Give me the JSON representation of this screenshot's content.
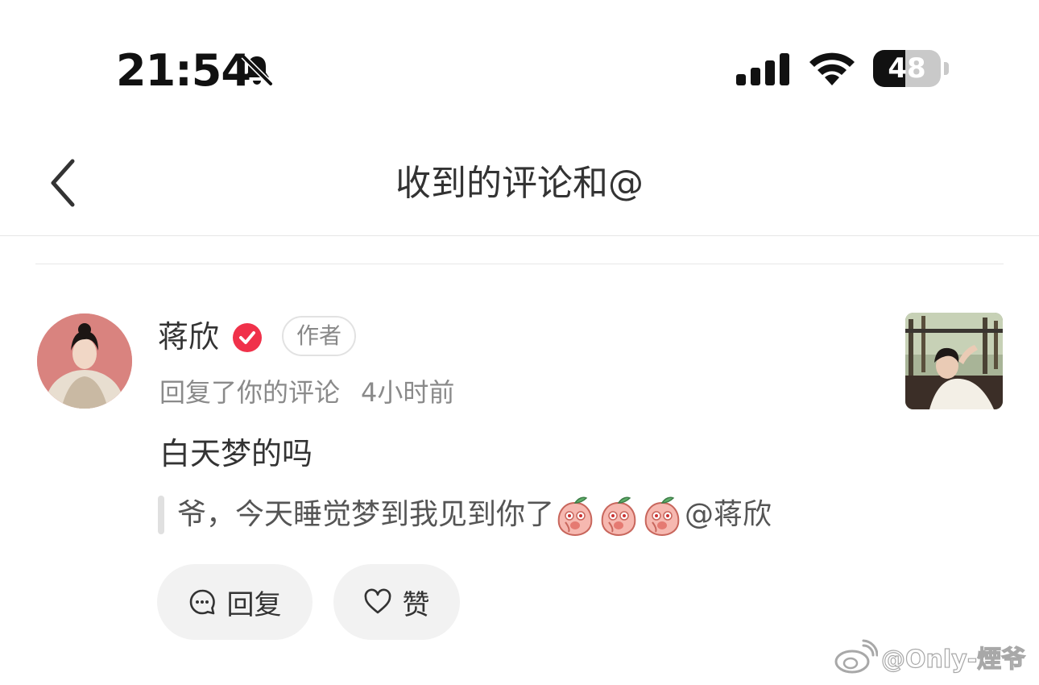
{
  "status_bar": {
    "time": "21:54",
    "battery_level": "48",
    "battery_fraction": 0.48,
    "icons": [
      "bell-slash-icon",
      "cellular-signal-icon",
      "wifi-icon",
      "battery-icon"
    ]
  },
  "header": {
    "title": "收到的评论和@",
    "back_icon": "chevron-left-icon"
  },
  "comment": {
    "author": "蒋欣",
    "author_tag": "作者",
    "verified_icon": "verified-check-icon",
    "action": "回复了你的评论",
    "time": "4小时前",
    "reply_text": "白天梦的吗",
    "quoted_text": "爷，今天睡觉梦到我见到你了",
    "quoted_emoji_count": 3,
    "quoted_mention": "@蒋欣"
  },
  "actions": {
    "reply_label": "回复",
    "like_label": "赞"
  },
  "watermark": {
    "text": "@Only-煙爷"
  },
  "colors": {
    "accent_red": "#f0314a",
    "button_bg": "#f2f2f2",
    "muted_text": "#8a8a8a"
  }
}
